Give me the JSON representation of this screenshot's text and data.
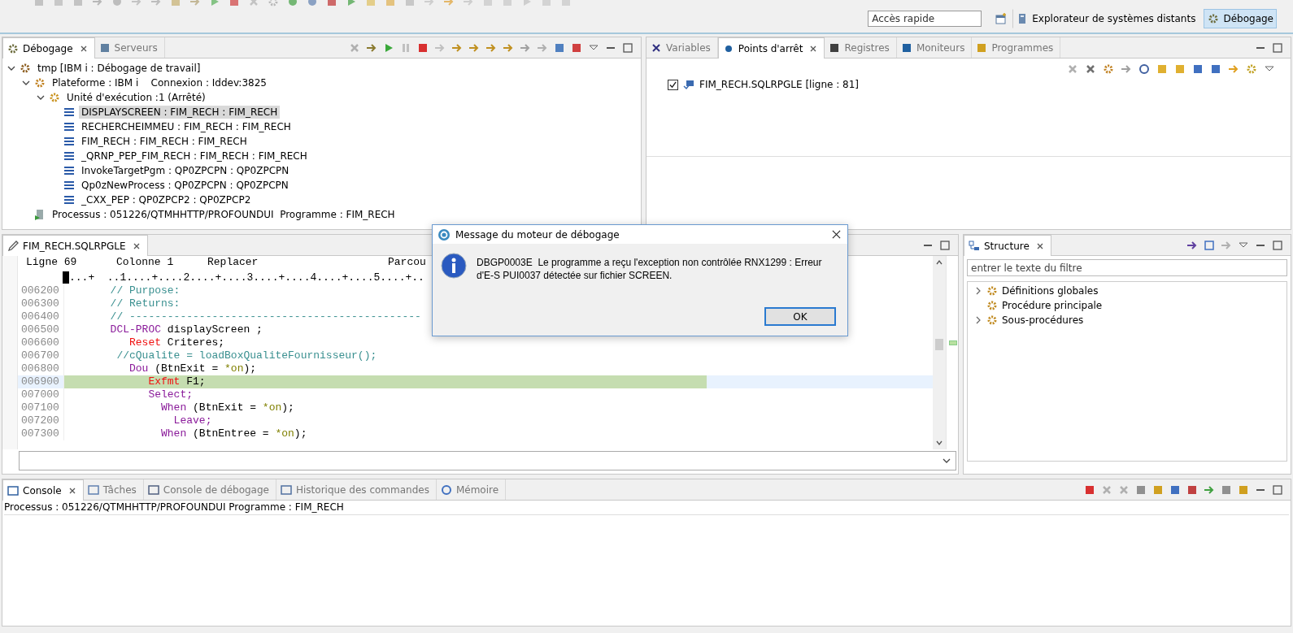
{
  "toolbar": {
    "quick_access": {
      "placeholder": "Accès rapide"
    },
    "perspectives": [
      {
        "label": "Explorateur de systèmes distants",
        "selected": false
      },
      {
        "label": "Débogage",
        "selected": true
      }
    ]
  },
  "debug_view": {
    "tabs": [
      {
        "label": "Débogage",
        "selected": true
      },
      {
        "label": "Serveurs",
        "selected": false
      }
    ],
    "tree": [
      {
        "kind": "launch",
        "label": "tmp [IBM i : Débogage de travail]",
        "expanded": true,
        "selected": false,
        "children": [
          {
            "kind": "platform",
            "label": "Plateforme : IBM i    Connexion : Iddev:3825",
            "expanded": true,
            "selected": false,
            "children": [
              {
                "kind": "thread",
                "label": "Unité d'exécution :1 (Arrêté)",
                "expanded": true,
                "selected": false,
                "children": [
                  {
                    "kind": "frame",
                    "label": "DISPLAYSCREEN : FIM_RECH : FIM_RECH",
                    "selected": true
                  },
                  {
                    "kind": "frame",
                    "label": "RECHERCHEIMMEU : FIM_RECH : FIM_RECH",
                    "selected": false
                  },
                  {
                    "kind": "frame",
                    "label": "FIM_RECH : FIM_RECH : FIM_RECH",
                    "selected": false
                  },
                  {
                    "kind": "frame",
                    "label": "_QRNP_PEP_FIM_RECH : FIM_RECH : FIM_RECH",
                    "selected": false
                  },
                  {
                    "kind": "frame",
                    "label": "InvokeTargetPgm : QP0ZPCPN : QP0ZPCPN",
                    "selected": false
                  },
                  {
                    "kind": "frame",
                    "label": "Qp0zNewProcess : QP0ZPCPN : QP0ZPCPN",
                    "selected": false
                  },
                  {
                    "kind": "frame",
                    "label": "_CXX_PEP : QP0ZPCP2 : QP0ZPCP2",
                    "selected": false
                  }
                ]
              }
            ]
          },
          {
            "kind": "process",
            "label": "Processus : 051226/QTMHHTTP/PROFOUNDUI  Programme : FIM_RECH",
            "selected": false
          }
        ]
      }
    ]
  },
  "breakpoints_view": {
    "tabs": [
      {
        "label": "Variables",
        "selected": false
      },
      {
        "label": "Points d'arrêt",
        "selected": true
      },
      {
        "label": "Registres",
        "selected": false
      },
      {
        "label": "Moniteurs",
        "selected": false
      },
      {
        "label": "Programmes",
        "selected": false
      }
    ],
    "breakpoints": [
      {
        "label": "FIM_RECH.SQLRPGLE [ligne : 81]",
        "checked": true
      }
    ]
  },
  "editor": {
    "tabs": [
      {
        "label": "FIM_RECH.SQLRPGLE",
        "selected": true
      }
    ],
    "status": [
      "Ligne 69",
      "Colonne 1",
      "Replacer",
      "Parcou"
    ],
    "ruler": "...+  ..1....+....2....+....3....+....4....+....5....+..",
    "lines": [
      {
        "number": "006200",
        "current": false,
        "segments": [
          {
            "kind": "comment",
            "text": "       // Purpose:"
          }
        ]
      },
      {
        "number": "006300",
        "current": false,
        "segments": [
          {
            "kind": "comment",
            "text": "       // Returns:"
          }
        ]
      },
      {
        "number": "006400",
        "current": false,
        "segments": [
          {
            "kind": "comment",
            "text": "       // ----------------------------------------------"
          }
        ]
      },
      {
        "number": "006500",
        "current": false,
        "segments": [
          {
            "kind": "keyword",
            "text": "       DCL-PROC"
          },
          {
            "kind": "text",
            "text": " displayScreen ;"
          }
        ]
      },
      {
        "number": "006600",
        "current": false,
        "segments": [
          {
            "kind": "opcode",
            "text": "          Reset"
          },
          {
            "kind": "text",
            "text": " Criteres;"
          }
        ]
      },
      {
        "number": "006700",
        "current": false,
        "segments": [
          {
            "kind": "comment",
            "text": "        //cQualite = loadBoxQualiteFournisseur();"
          }
        ]
      },
      {
        "number": "006800",
        "current": false,
        "segments": [
          {
            "kind": "keyword",
            "text": "          Dou"
          },
          {
            "kind": "text",
            "text": " (BtnExit = "
          },
          {
            "kind": "literal",
            "text": "*on"
          },
          {
            "kind": "text",
            "text": ");"
          }
        ]
      },
      {
        "number": "006900",
        "current": true,
        "segments": [
          {
            "kind": "opcode",
            "text": "             Exfmt"
          },
          {
            "kind": "text",
            "text": " F1;"
          }
        ]
      },
      {
        "number": "007000",
        "current": false,
        "segments": [
          {
            "kind": "keyword",
            "text": "             Select;"
          }
        ]
      },
      {
        "number": "007100",
        "current": false,
        "segments": [
          {
            "kind": "keyword",
            "text": "               When"
          },
          {
            "kind": "text",
            "text": " (BtnExit = "
          },
          {
            "kind": "literal",
            "text": "*on"
          },
          {
            "kind": "text",
            "text": ");"
          }
        ]
      },
      {
        "number": "007200",
        "current": false,
        "segments": [
          {
            "kind": "keyword",
            "text": "                 Leave;"
          }
        ]
      },
      {
        "number": "007300",
        "current": false,
        "segments": [
          {
            "kind": "keyword",
            "text": "               When"
          },
          {
            "kind": "text",
            "text": " (BtnEntree = "
          },
          {
            "kind": "literal",
            "text": "*on"
          },
          {
            "kind": "text",
            "text": ");"
          }
        ]
      }
    ]
  },
  "outline_view": {
    "tabs": [
      {
        "label": "Structure",
        "selected": true
      }
    ],
    "filter": {
      "placeholder": "entrer le texte du filtre"
    },
    "items": [
      {
        "kind": "branch",
        "label": "Définitions globales"
      },
      {
        "kind": "leaf",
        "label": "Procédure principale"
      },
      {
        "kind": "branch",
        "label": "Sous-procédures"
      }
    ]
  },
  "console_view": {
    "tabs": [
      {
        "label": "Console",
        "selected": true
      },
      {
        "label": "Tâches",
        "selected": false
      },
      {
        "label": "Console de débogage",
        "selected": false
      },
      {
        "label": "Historique des commandes",
        "selected": false
      },
      {
        "label": "Mémoire",
        "selected": false
      }
    ],
    "text": "Processus : 051226/QTMHHTTP/PROFOUNDUI  Programme : FIM_RECH"
  },
  "dialog": {
    "title": "Message du moteur de débogage",
    "message": "DBGP0003E  Le programme a reçu l'exception non contrôlée RNX1299 : Erreur d'E-S PUI0037 détectée sur fichier SCREEN.",
    "button": "OK"
  }
}
